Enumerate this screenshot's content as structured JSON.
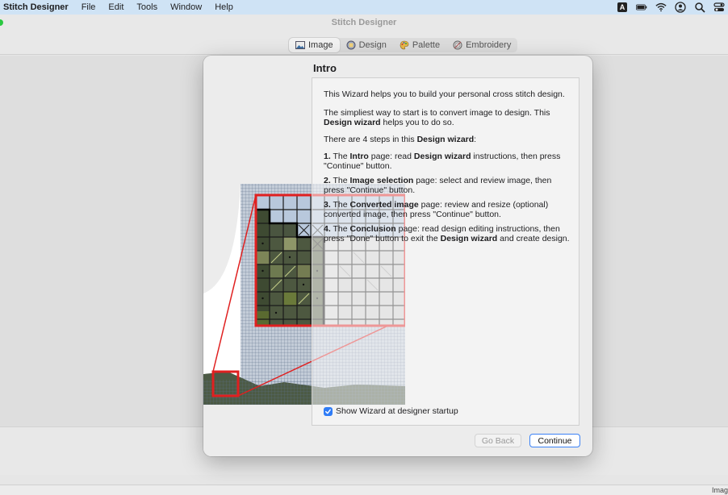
{
  "menubar": {
    "app_name": "Stitch Designer",
    "items": [
      "File",
      "Edit",
      "Tools",
      "Window",
      "Help"
    ],
    "status_icons": [
      "keyboard-input-icon",
      "battery-icon",
      "wifi-icon",
      "user-icon",
      "search-icon",
      "control-center-icon"
    ],
    "input_source": "A"
  },
  "window": {
    "title": "Stitch Designer",
    "tabs": [
      {
        "label": "Image",
        "icon": "image-icon",
        "active": true
      },
      {
        "label": "Design",
        "icon": "design-icon",
        "active": false
      },
      {
        "label": "Palette",
        "icon": "palette-icon",
        "active": false
      },
      {
        "label": "Embroidery",
        "icon": "embroidery-icon",
        "active": false
      }
    ],
    "status_text": "Imag"
  },
  "wizard": {
    "page_title": "Intro",
    "intro_line": "This Wizard helps you to build your personal cross stitch design.",
    "simpliest_line": "The simpliest way to start is to convert image to design. This",
    "simpliest_bold": "Design wizard",
    "simpliest_tail": " helps you to do so.",
    "steps_intro": "There are 4 steps in this ",
    "steps_intro_bold": "Design wizard",
    "steps_intro_tail": ":",
    "steps": [
      {
        "num": "1.",
        "pre": " The ",
        "page": "Intro",
        "mid": " page: read ",
        "bold2": "Design wizard",
        "tail": " instructions, then press \"Continue\" button."
      },
      {
        "num": "2.",
        "pre": " The ",
        "page": "Image selection",
        "mid": " page: select and review image, then press \"Continue\" button.",
        "bold2": "",
        "tail": ""
      },
      {
        "num": "3.",
        "pre": " The ",
        "page": "Converted image",
        "mid": " page: review and resize (optional) converted image, then press \"Continue\" button.",
        "bold2": "",
        "tail": ""
      },
      {
        "num": "4.",
        "pre": " The ",
        "page": "Conclusion",
        "mid": " page: read design editing instructions, then press \"Done\" button to exit the ",
        "bold2": "Design wizard",
        "tail": " and create design."
      }
    ],
    "checkbox_label": "Show Wizard at designer startup",
    "checkbox_checked": true,
    "back_label": "Go Back",
    "continue_label": "Continue"
  },
  "colors": {
    "accent": "#2f7cf6",
    "zoom_frame": "#e02020",
    "menubar_bg": "#cfe3f5"
  }
}
